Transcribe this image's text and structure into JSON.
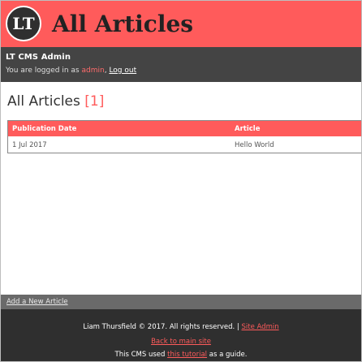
{
  "header": {
    "logo_text": "LT",
    "title": "All Articles"
  },
  "admin_bar": {
    "title": "LT CMS Admin",
    "logged_in_prefix": "You are logged in as",
    "username": "admin",
    "separator": ",",
    "logout_label": "Log out"
  },
  "main": {
    "heading": "All Articles",
    "count": "[1]",
    "table": {
      "columns": [
        "Publication Date",
        "Article"
      ],
      "rows": [
        {
          "date": "1 Jul 2017",
          "title": "Hello World"
        }
      ]
    }
  },
  "bottom_bar": {
    "add_link": "Add a New Article"
  },
  "footer": {
    "copyright": "Liam Thursfield © 2017. All rights reserved. |",
    "site_admin_link": "Site Admin",
    "back_link": "Back to main site",
    "credit_prefix": "This CMS used",
    "credit_link": "this tutorial",
    "credit_suffix": "as a guide."
  },
  "colors": {
    "accent": "#ff5b5b",
    "dark": "#2f2f2f",
    "admin_bg": "#444444"
  }
}
